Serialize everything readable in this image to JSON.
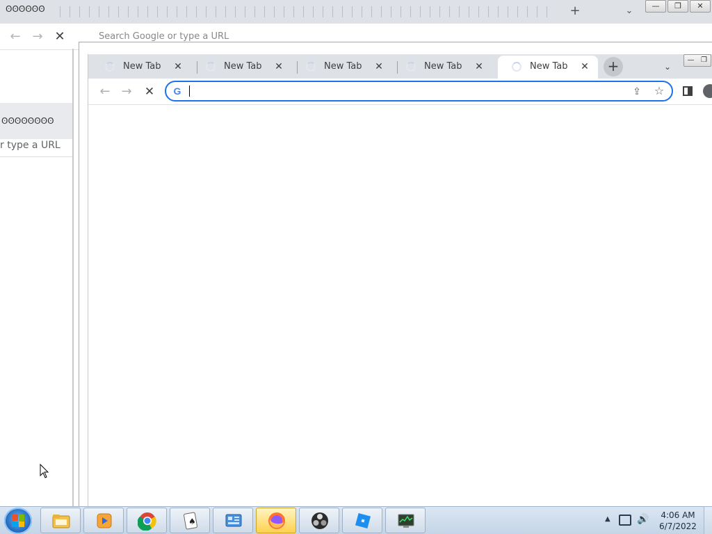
{
  "background_window": {
    "tab_icons": "ʘʘʘʘʘʘ",
    "omnibox_text": "Search Google or type a URL",
    "side_icons": "ʘʘʘʘʘʘʘʘ",
    "side_url_text": "r type a URL",
    "new_tab_glyph": "+",
    "chevron_glyph": "⌄",
    "win_buttons": [
      "—",
      "❐",
      "✕"
    ],
    "back_glyph": "←",
    "forward_glyph": "→",
    "stop_glyph": "✕"
  },
  "tabs": [
    {
      "label": "New Tab",
      "close": "✕",
      "active": false
    },
    {
      "label": "New Tab",
      "close": "✕",
      "active": false
    },
    {
      "label": "New Tab",
      "close": "✕",
      "active": false
    },
    {
      "label": "New Tab",
      "close": "✕",
      "active": false
    },
    {
      "label": "New Tab",
      "close": "✕",
      "active": true
    }
  ],
  "tabstrip": {
    "new_tab_glyph": "+",
    "search_tabs_glyph": "⌄",
    "window_buttons": [
      "—",
      "❐"
    ]
  },
  "toolbar": {
    "back_glyph": "←",
    "forward_glyph": "→",
    "stop_glyph": "✕",
    "google_icon_letter": "G",
    "omnibox_value": "",
    "omnibox_placeholder": "",
    "share_glyph": "⇪",
    "star_glyph": "☆"
  },
  "taskbar": {
    "apps": [
      {
        "name": "file-explorer",
        "active": false
      },
      {
        "name": "media-player",
        "active": false
      },
      {
        "name": "chrome",
        "active": false
      },
      {
        "name": "solitaire",
        "active": false
      },
      {
        "name": "control-panel",
        "active": false
      },
      {
        "name": "firefox",
        "active": true
      },
      {
        "name": "obs",
        "active": false
      },
      {
        "name": "roblox",
        "active": false
      },
      {
        "name": "task-manager",
        "active": false
      }
    ],
    "tray_up_glyph": "▲",
    "volume_glyph": "🔊",
    "clock_time": "4:06 AM",
    "clock_date": "6/7/2022"
  },
  "colors": {
    "accent": "#1a73e8",
    "tabstrip_bg": "#dee1e6",
    "taskbar_top": "#dbe6f2",
    "taskbar_bottom": "#c5d5e7"
  }
}
